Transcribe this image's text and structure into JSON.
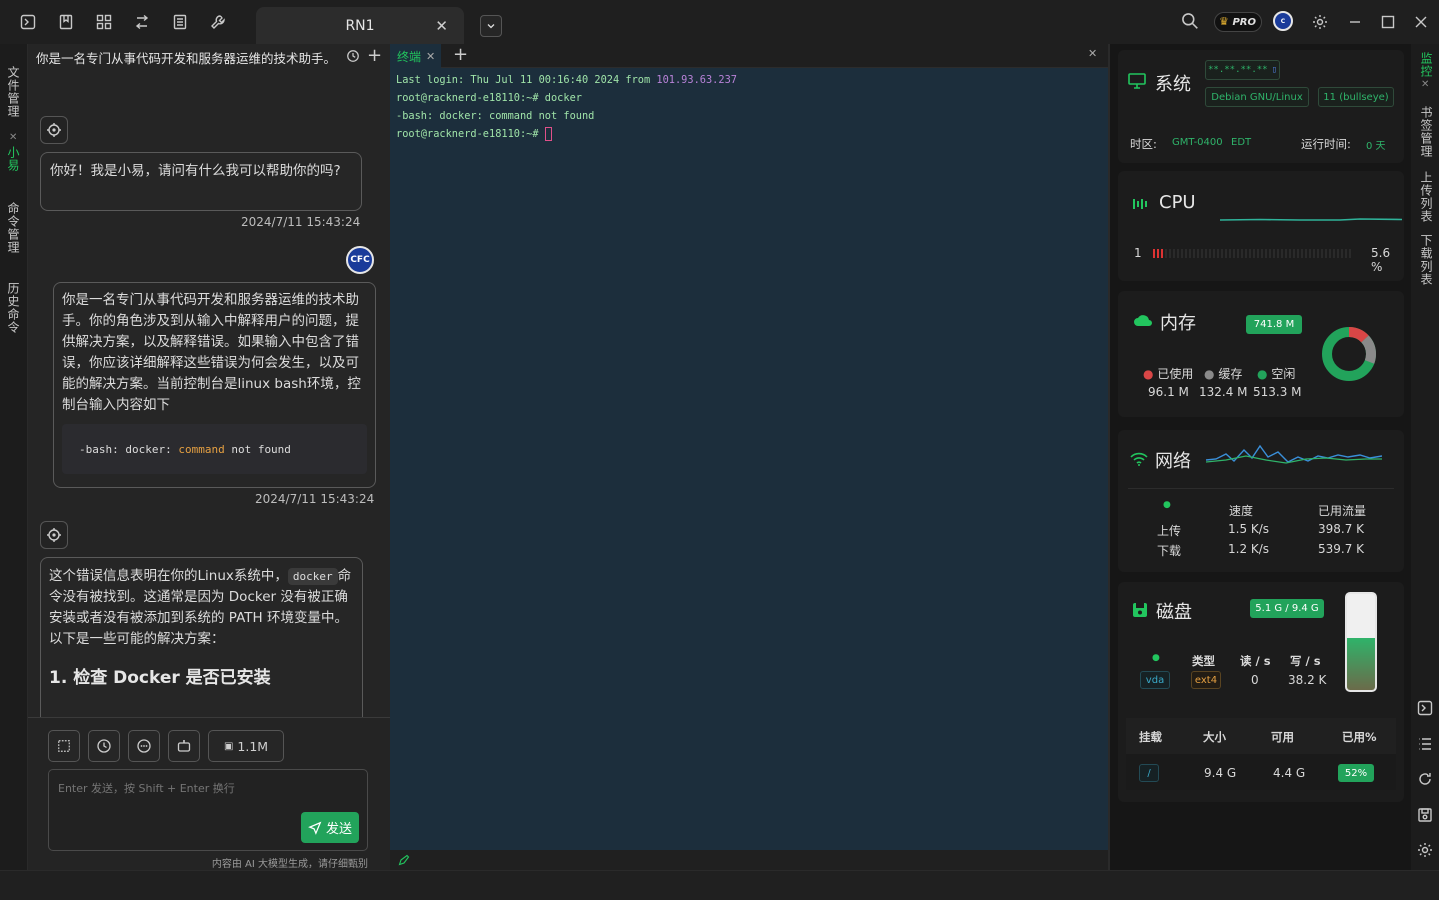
{
  "window": {
    "active_tab": "RN1"
  },
  "topbar": {
    "pro_label": "PRO"
  },
  "leftbar": {
    "tabs": [
      "文件管理",
      "小易",
      "命令管理",
      "历史命令"
    ]
  },
  "chat": {
    "title": "你是一名专门从事代码开发和服务器运维的技术助手。...",
    "greeting": "你好！我是小易，请问有什么我可以帮助你的吗?",
    "greeting_time": "2024/7/11 15:43:24",
    "user_avatar": "CFC",
    "user_message": "你是一名专门从事代码开发和服务器运维的技术助手。你的角色涉及到从输入中解释用户的问题，提供解决方案，以及解释错误。如果输入中包含了错误，你应该详细解释这些错误为何会发生，以及可能的解决方案。当前控制台是linux bash环境，控制台输入内容如下",
    "user_code": {
      "a": "-bash: docker: ",
      "kw": "command",
      "b": " not found"
    },
    "user_time": "2024/7/11 15:43:24",
    "reply_part1": "这个错误信息表明在你的Linux系统中，",
    "reply_code": "docker",
    "reply_part2": "命令没有被找到。这通常是因为 Docker 没有被正确安装或者没有被添加到系统的 PATH 环境变量中。以下是一些可能的解决方案：",
    "reply_heading": "1. 检查 Docker 是否已安装",
    "token_count": "1.1M",
    "input_placeholder": "Enter 发送，按 Shift + Enter 换行",
    "send_label": "发送",
    "disclaimer": "内容由 AI 大模型生成，请仔细甄别"
  },
  "terminal": {
    "tab_label": "终端",
    "lines": {
      "l1a": "Last login: Thu Jul 11 00:16:40 2024 from ",
      "l1ip": "101.93.63.237",
      "l2": "root@racknerd-e18110:~# docker",
      "l3": "-bash: docker: command not found",
      "l4": "root@racknerd-e18110:~# "
    }
  },
  "sysmon": {
    "system": {
      "title": "系统",
      "masked": "**.**.**.**",
      "os": "Debian GNU/Linux",
      "version": "11 (bullseye)",
      "tz_label": "时区:",
      "tz_value": "GMT-0400",
      "tz_abbr": "EDT",
      "uptime_label": "运行时间:",
      "uptime_value": "0 天"
    },
    "cpu": {
      "title": "CPU",
      "core": "1",
      "usage": "5.6 %"
    },
    "memory": {
      "title": "内存",
      "total": "741.8 M",
      "used_label": "已使用",
      "cache_label": "缓存",
      "free_label": "空闲",
      "used": "96.1 M",
      "cache": "132.4 M",
      "free": "513.3 M"
    },
    "network": {
      "title": "网络",
      "h_speed": "速度",
      "h_traffic": "已用流量",
      "up_label": "上传",
      "down_label": "下载",
      "up_speed": "1.5 K/s",
      "down_speed": "1.2 K/s",
      "up_total": "398.7 K",
      "down_total": "539.7 K"
    },
    "disk": {
      "title": "磁盘",
      "usage": "5.1 G / 9.4 G",
      "h_type": "类型",
      "h_read": "读 / s",
      "h_write": "写 / s",
      "dev": "vda",
      "fs": "ext4",
      "read": "0",
      "write": "38.2 K",
      "h_mount": "挂载",
      "h_size": "大小",
      "h_avail": "可用",
      "h_pct": "已用%",
      "mount": "/",
      "size": "9.4 G",
      "avail": "4.4 G",
      "pct": "52%",
      "fill": 0.54
    }
  },
  "rightbar": {
    "tabs": [
      "监控",
      "书签管理",
      "上传列表",
      "下载列表"
    ]
  }
}
